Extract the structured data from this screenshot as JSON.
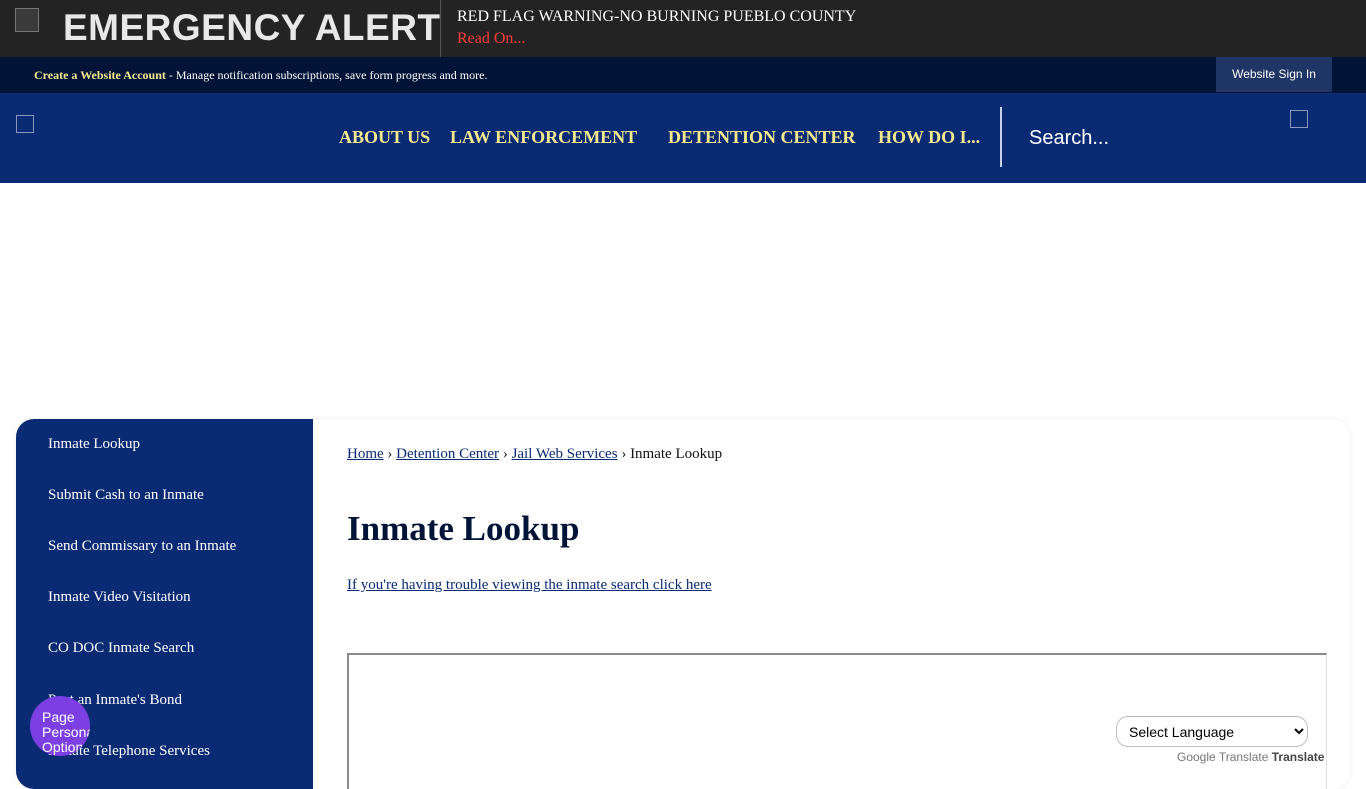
{
  "alert": {
    "title": "EMERGENCY ALERT",
    "message": "RED FLAG WARNING-NO BURNING PUEBLO COUNTY",
    "read_on": "Read On..."
  },
  "account_bar": {
    "create_link": "Create a Website Account",
    "description": " - Manage notification subscriptions, save form progress and more.",
    "signin_label": "Website Sign In"
  },
  "nav": {
    "items": [
      {
        "label": "ABOUT US"
      },
      {
        "label": "LAW ENFORCEMENT"
      },
      {
        "label": "DETENTION CENTER"
      },
      {
        "label": "HOW DO I..."
      }
    ]
  },
  "search": {
    "placeholder": "Search..."
  },
  "sidebar": {
    "items": [
      {
        "label": "Inmate Lookup"
      },
      {
        "label": "Submit Cash to an Inmate"
      },
      {
        "label": "Send Commissary to an Inmate"
      },
      {
        "label": "Inmate Video Visitation"
      },
      {
        "label": "CO DOC Inmate Search"
      },
      {
        "label": "Post an Inmate's Bond"
      },
      {
        "label": "Inmate Telephone Services"
      }
    ]
  },
  "breadcrumb": {
    "home": "Home",
    "detention": "Detention Center",
    "jail": "Jail Web Services",
    "current": "Inmate Lookup",
    "separator": " › "
  },
  "main": {
    "title": "Inmate Lookup",
    "trouble_link": "If you're having trouble viewing the inmate search click here"
  },
  "translate": {
    "select_label": "Select Language",
    "attribution_logo": "Google Translate",
    "attribution_text": "Translate"
  },
  "page_options": {
    "label": "Page Personalization Options"
  },
  "icons": {
    "alert": "alert-icon",
    "logo": "county-logo",
    "search": "search-icon",
    "page_options": "page-options-icon"
  },
  "colors": {
    "alert_background": "#232323",
    "account_bar": "#011336",
    "header": "#0a2a74",
    "nav_text": "#f5e98f",
    "read_on": "#ff3b3b",
    "page_options": "#7b3fe4"
  }
}
